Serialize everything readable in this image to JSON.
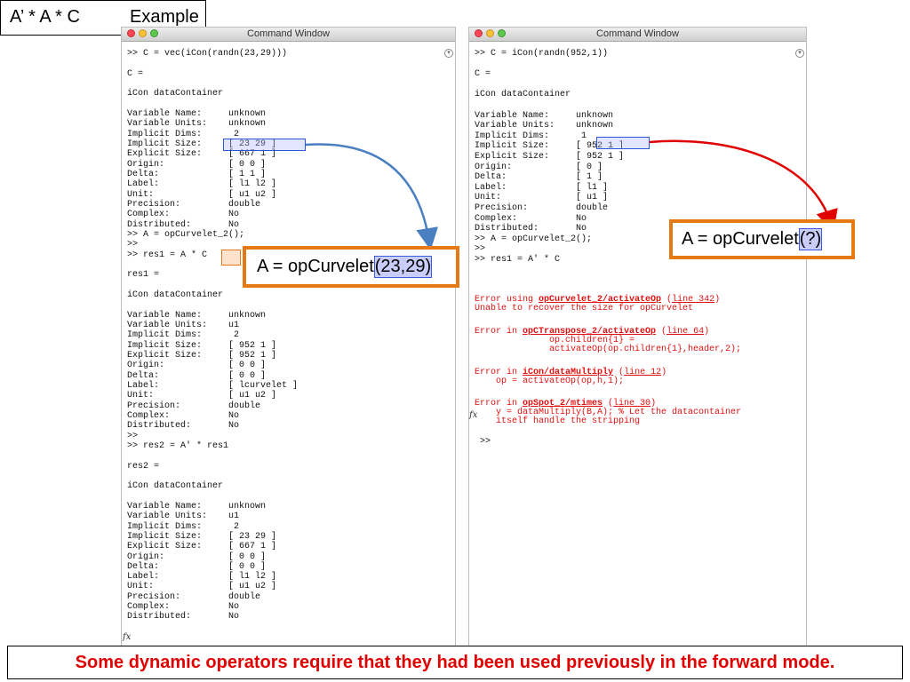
{
  "title": {
    "part1": "A’ * A * C",
    "part2": "Example"
  },
  "left_window": {
    "title": "Command Window",
    "lines": [
      ">> C = vec(iCon(randn(23,29)))",
      "",
      "C =",
      "",
      "iCon dataContainer",
      "",
      "Variable Name:     unknown",
      "Variable Units:    unknown",
      "Implicit Dims:      2",
      "Implicit Size:     [ 23 29 ]",
      "Explicit Size:     [ 667 1 ]",
      "Origin:            [ 0 0 ]",
      "Delta:             [ 1 1 ]",
      "Label:             [ l1 l2 ]",
      "Unit:              [ u1 u2 ]",
      "Precision:         double",
      "Complex:           No",
      "Distributed:       No",
      ">> A = opCurvelet_2();",
      ">>",
      ">> res1 = A * C",
      "",
      "res1 =",
      "",
      "iCon dataContainer",
      "",
      "Variable Name:     unknown",
      "Variable Units:    u1",
      "Implicit Dims:      2",
      "Implicit Size:     [ 952 1 ]",
      "Explicit Size:     [ 952 1 ]",
      "Origin:            [ 0 0 ]",
      "Delta:             [ 0 0 ]",
      "Label:             [ lcurvelet ]",
      "Unit:              [ u1 u2 ]",
      "Precision:         double",
      "Complex:           No",
      "Distributed:       No",
      ">>",
      ">> res2 = A' * res1",
      "",
      "res2 =",
      "",
      "iCon dataContainer",
      "",
      "Variable Name:     unknown",
      "Variable Units:    u1",
      "Implicit Dims:      2",
      "Implicit Size:     [ 23 29 ]",
      "Explicit Size:     [ 667 1 ]",
      "Origin:            [ 0 0 ]",
      "Delta:             [ 0 0 ]",
      "Label:             [ l1 l2 ]",
      "Unit:              [ u1 u2 ]",
      "Precision:         double",
      "Complex:           No",
      "Distributed:       No"
    ],
    "prompt": ">>",
    "fx": "fx"
  },
  "right_window": {
    "title": "Command Window",
    "lines": [
      ">> C = iCon(randn(952,1))",
      "",
      "C =",
      "",
      "iCon dataContainer",
      "",
      "Variable Name:     unknown",
      "Variable Units:    unknown",
      "Implicit Dims:      1",
      "Implicit Size:     [ 952 1 ]",
      "Explicit Size:     [ 952 1 ]",
      "Origin:            [ 0 ]",
      "Delta:             [ 1 ]",
      "Label:             [ l1 ]",
      "Unit:              [ u1 ]",
      "Precision:         double",
      "Complex:           No",
      "Distributed:       No",
      ">> A = opCurvelet_2();",
      ">>",
      ">> res1 = A' * C"
    ],
    "errors": {
      "e1_prefix": "Error using ",
      "e1_func": "opCurvelet_2/activateOp",
      "e1_line": "line 342",
      "e1_msg": "Unable to recover the size for opCurvelet",
      "e2_prefix": "Error in ",
      "e2_func": "opCTranspose_2/activateOp",
      "e2_line": "line 64",
      "e2_code1": "              op.children{1} =",
      "e2_code2": "              activateOp(op.children{1},header,2);",
      "e3_prefix": "Error in ",
      "e3_func": "iCon/dataMultiply",
      "e3_line": "line 12",
      "e3_code": "    op = activateOp(op,h,1);",
      "e4_prefix": "Error in ",
      "e4_func": "opSpot_2/mtimes",
      "e4_line": "line 30",
      "e4_code1": "    y = dataMultiply(B,A); % Let the datacontainer",
      "e4_code2": "    itself handle the stripping"
    },
    "prompt": ">>",
    "fx": "fx"
  },
  "callout_left": {
    "text": "A = opCurvelet",
    "highlight": "(23,29)"
  },
  "callout_right": {
    "text": "A = opCurvelet",
    "highlight": "(?)"
  },
  "footer": "Some dynamic operators require that they had been used previously in the forward mode.",
  "colors": {
    "orange": "#e57a14",
    "blue_arrow": "#4a7fc1",
    "red_arrow": "#e00000",
    "error_red": "#e01010"
  }
}
